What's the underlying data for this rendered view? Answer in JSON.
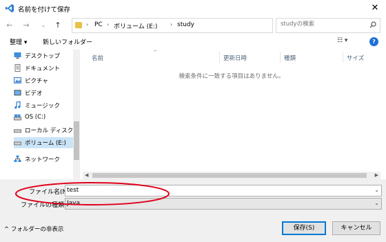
{
  "window": {
    "title": "名前を付けて保存"
  },
  "address_bar": {
    "segments": [
      "PC",
      "ボリューム (E:)",
      "study"
    ],
    "search_placeholder": "studyの検索"
  },
  "toolbar": {
    "organize": "整理 ▾",
    "new_folder": "新しいフォルダー"
  },
  "nav_pane": {
    "items": [
      {
        "label": "デスクトップ",
        "icon": "desktop-icon"
      },
      {
        "label": "ドキュメント",
        "icon": "documents-icon"
      },
      {
        "label": "ピクチャ",
        "icon": "pictures-icon"
      },
      {
        "label": "ビデオ",
        "icon": "videos-icon"
      },
      {
        "label": "ミュージック",
        "icon": "music-icon"
      },
      {
        "label": "OS (C:)",
        "icon": "drive-icon"
      },
      {
        "label": "ローカル ディスク (D",
        "icon": "drive-icon"
      },
      {
        "label": "ボリューム (E:)",
        "icon": "drive-icon"
      },
      {
        "label": "ネットワーク",
        "icon": "network-icon"
      }
    ]
  },
  "file_list": {
    "columns": [
      "名前",
      "更新日時",
      "種類",
      "サイズ"
    ],
    "empty_message": "検索条件に一致する項目はありません。"
  },
  "form": {
    "filename_label": "ファイル名(N):",
    "filename_value": "test",
    "filetype_label": "ファイルの種類(T):",
    "filetype_value": "Java"
  },
  "footer": {
    "hide_folders": "フォルダーの非表示",
    "save": "保存(S)",
    "cancel": "キャンセル"
  },
  "colors": {
    "accent": "#0078d7",
    "annotation": "#e0001b",
    "selection": "#cce4f7"
  }
}
